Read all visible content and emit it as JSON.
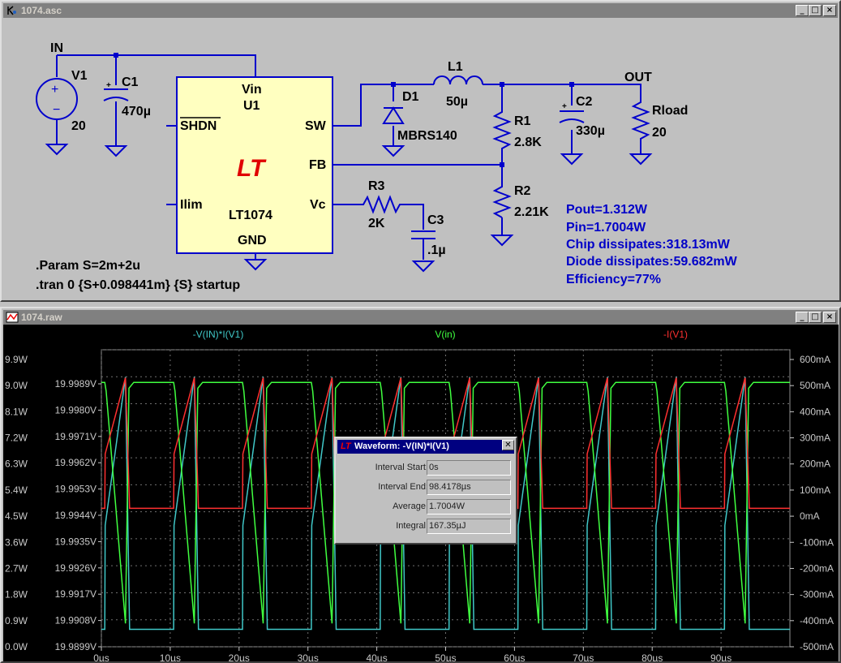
{
  "schematic_window": {
    "title": "1074.asc",
    "buttons": [
      "_",
      "□",
      "×"
    ],
    "labels": {
      "in": "IN",
      "out": "OUT",
      "v1": "V1",
      "v1_value": "20",
      "c1": "C1",
      "c1_value": "470µ",
      "c1_plus": "+",
      "u1_vin": "Vin",
      "u1_name": "U1",
      "u1_shdn": "SHDN",
      "u1_sw": "SW",
      "u1_fb": "FB",
      "u1_ilim": "Ilim",
      "u1_vc": "Vc",
      "u1_part": "LT1074",
      "u1_gnd": "GND",
      "d1": "D1",
      "d1_value": "MBRS140",
      "l1": "L1",
      "l1_value": "50µ",
      "r1": "R1",
      "r1_value": "2.8K",
      "r2": "R2",
      "r2_value": "2.21K",
      "r3": "R3",
      "r3_value": "2K",
      "c2": "C2",
      "c2_value": "330µ",
      "c2_plus": "+",
      "c3": "C3",
      "c3_value": ".1µ",
      "rload": "Rload",
      "rload_value": "20",
      "param": ".Param S=2m+2u",
      "tran": ".tran 0 {S+0.098441m} {S} startup"
    },
    "results": [
      "Pout=1.312W",
      "Pin=1.7004W",
      "Chip dissipates:318.13mW",
      "Diode dissipates:59.682mW",
      "Efficiency=77%"
    ]
  },
  "waveform_window": {
    "title": "1074.raw",
    "buttons": [
      "_",
      "□",
      "×"
    ]
  },
  "colors": {
    "wire": "#0000cc",
    "schematic_bg": "#c0c0c0",
    "ic_fill": "#ffffc0",
    "result_text": "#0000c8",
    "plot_bg": "#000000",
    "trace_power": "#40c8c8",
    "trace_vin": "#40ff40",
    "trace_current": "#ff3030",
    "axis_text": "#c8c8c8"
  },
  "chart_data": {
    "type": "line",
    "series": [
      {
        "name": "-V(IN)*I(V1)",
        "axis": "power",
        "levels": [
          0.6,
          9.3
        ],
        "color": "#40c8c8"
      },
      {
        "name": "V(in)",
        "axis": "vin",
        "levels": [
          19.9907,
          19.99895
        ],
        "color": "#40ff40"
      },
      {
        "name": "-I(V1)",
        "axis": "current",
        "levels": [
          30,
          530
        ],
        "color": "#ff3030"
      }
    ],
    "switch_events_us": [
      0.5,
      3.5,
      10.5,
      13.5,
      20.5,
      23.5,
      30.5,
      33.5,
      40.5,
      43.5,
      50.5,
      53.5,
      60.5,
      63.5,
      70.5,
      73.5,
      80.5,
      83.5,
      90.5,
      93.5
    ],
    "period_us": 10,
    "on_start_us": 0.5,
    "on_end_us": 3.5,
    "xlim": [
      0,
      100
    ],
    "x_ticks": [
      "0µs",
      "10µs",
      "20µs",
      "30µs",
      "40µs",
      "50µs",
      "60µs",
      "70µs",
      "80µs",
      "90µs"
    ],
    "y_ticks_power": [
      "9.9W",
      "9.0W",
      "8.1W",
      "7.2W",
      "6.3W",
      "5.4W",
      "4.5W",
      "3.6W",
      "2.7W",
      "1.8W",
      "0.9W",
      "0.0W"
    ],
    "y_ticks_vin": [
      "19.9989V",
      "19.9980V",
      "19.9971V",
      "19.9962V",
      "19.9953V",
      "19.9944V",
      "19.9935V",
      "19.9926V",
      "19.9917V",
      "19.9908V",
      "19.9899V"
    ],
    "y_ticks_current": [
      "600mA",
      "500mA",
      "400mA",
      "300mA",
      "200mA",
      "100mA",
      "0mA",
      "-100mA",
      "-200mA",
      "-300mA",
      "-400mA",
      "-500mA"
    ],
    "grid": true
  },
  "dialog": {
    "title": "Waveform: -V(IN)*I(V1)",
    "logo": "LT",
    "rows": [
      {
        "label": "Interval Start:",
        "value": "0s"
      },
      {
        "label": "Interval End:",
        "value": "98.4178µs"
      },
      {
        "label": "Average:",
        "value": "1.7004W"
      },
      {
        "label": "Integral:",
        "value": "167.35µJ"
      }
    ]
  }
}
